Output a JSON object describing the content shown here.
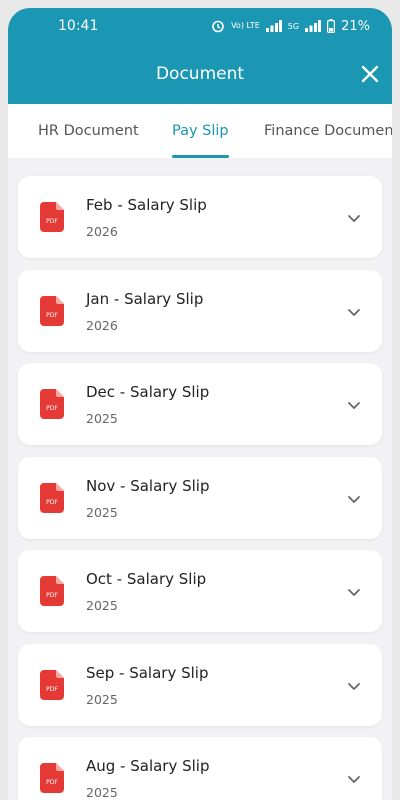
{
  "status_bar": {
    "time": "10:41",
    "network_label": "Vo) LTE",
    "signal_label": "5G",
    "battery": "21%"
  },
  "header": {
    "title": "Document"
  },
  "tabs": [
    {
      "label": "HR Document",
      "active": false
    },
    {
      "label": "Pay Slip",
      "active": true
    },
    {
      "label": "Finance Documen",
      "active": false
    }
  ],
  "documents": [
    {
      "title": "Feb - Salary Slip",
      "year": "2026",
      "icon": "pdf-icon"
    },
    {
      "title": "Jan - Salary Slip",
      "year": "2026",
      "icon": "pdf-icon"
    },
    {
      "title": "Dec - Salary Slip",
      "year": "2025",
      "icon": "pdf-icon"
    },
    {
      "title": "Nov - Salary Slip",
      "year": "2025",
      "icon": "pdf-icon"
    },
    {
      "title": "Oct - Salary Slip",
      "year": "2025",
      "icon": "pdf-icon"
    },
    {
      "title": "Sep - Salary Slip",
      "year": "2025",
      "icon": "pdf-icon"
    },
    {
      "title": "Aug - Salary Slip",
      "year": "2025",
      "icon": "pdf-icon"
    }
  ],
  "colors": {
    "primary": "#1b97b3",
    "pdf_red": "#e53935",
    "background": "#f2f2f4"
  }
}
